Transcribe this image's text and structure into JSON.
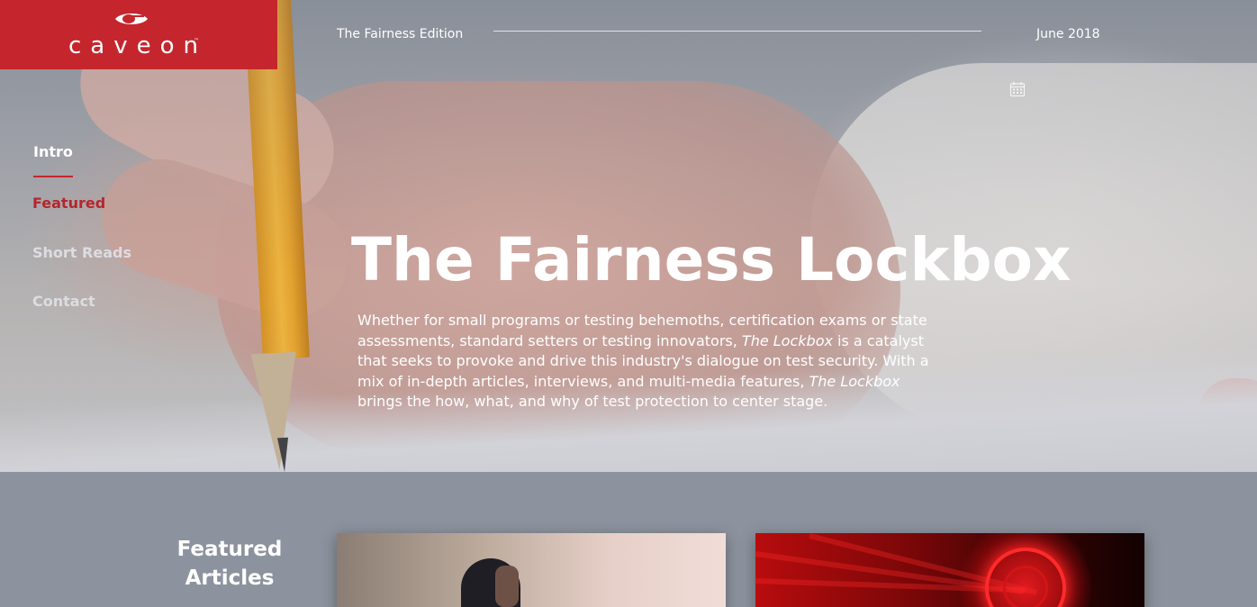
{
  "brand": {
    "logo_text": "caveon",
    "logo_tm": "™",
    "brand_color": "#c5262d"
  },
  "header": {
    "edition": "The Fairness Edition",
    "date": "June 2018",
    "calendar_icon": "calendar-icon"
  },
  "nav": {
    "items": [
      {
        "label": "Intro",
        "state": "current"
      },
      {
        "label": "Featured",
        "state": "highlighted"
      },
      {
        "label": "Short Reads",
        "state": "default"
      },
      {
        "label": "Contact",
        "state": "default"
      }
    ]
  },
  "hero": {
    "title": "The Fairness Lockbox",
    "body_part1": "Whether for small programs or testing behemoths, certification exams or state assessments, standard setters or testing innovators, ",
    "body_em1": "The Lockbox",
    "body_part2": " is a catalyst that seeks to provoke and drive this industry's dialogue on test security. With a mix of in-depth articles, interviews, and multi-media features, ",
    "body_em2": "The Lockbox",
    "body_part3": " brings the how, what, and why of test protection to center stage."
  },
  "featured": {
    "heading": "Featured Articles",
    "cards": [
      {
        "image": "person-silhouette-photo"
      },
      {
        "image": "red-vault-dial-photo"
      }
    ]
  }
}
